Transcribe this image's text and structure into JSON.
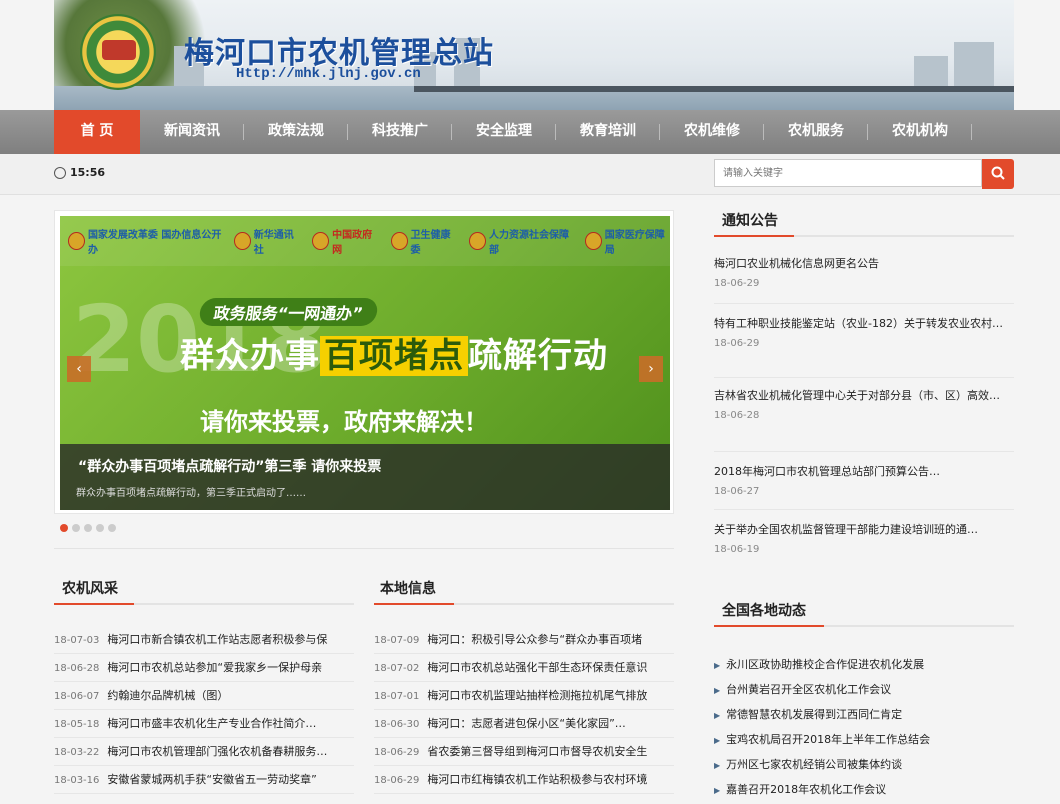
{
  "header": {
    "site_title": "梅河口市农机管理总站",
    "site_url": "Http://mhk.jlnj.gov.cn"
  },
  "nav": {
    "items": [
      {
        "label": "首 页",
        "active": true
      },
      {
        "label": "新闻资讯"
      },
      {
        "label": "政策法规"
      },
      {
        "label": "科技推广"
      },
      {
        "label": "安全监理"
      },
      {
        "label": "教育培训"
      },
      {
        "label": "农机维修"
      },
      {
        "label": "农机服务"
      },
      {
        "label": "农机机构"
      }
    ]
  },
  "toolbar": {
    "time": "15:56",
    "search_placeholder": "请输入关键字"
  },
  "slider": {
    "orgs": [
      "国家发展改革委 国办信息公开办",
      "新华通讯社",
      "中国政府网",
      "卫生健康委",
      "人力资源社会保障部",
      "国家医疗保障局"
    ],
    "year_text": "2018",
    "pill": "政务服务“一网通办”",
    "headline_a": "群众办事",
    "headline_b": "百项堵点",
    "headline_c": "疏解行动",
    "sub": "请你来投票，政府来解决！",
    "caption_title": "“群众办事百项堵点疏解行动”第三季 请你来投票",
    "caption_desc": "群众办事百项堵点疏解行动，第三季正式启动了……",
    "prev": "‹",
    "next": "›",
    "dot_count": 5,
    "active_dot": 1
  },
  "nongji": {
    "title": "农机风采",
    "items": [
      {
        "date": "18-07-03",
        "text": "梅河口市新合镇农机工作站志愿者积极参与保"
      },
      {
        "date": "18-06-28",
        "text": "梅河口市农机总站参加“爱我家乡一保护母亲"
      },
      {
        "date": "18-06-07",
        "text": "约翰迪尔品牌机械（图）"
      },
      {
        "date": "18-05-18",
        "text": "梅河口市盛丰农机化生产专业合作社简介…"
      },
      {
        "date": "18-03-22",
        "text": "梅河口市农机管理部门强化农机备春耕服务…"
      },
      {
        "date": "18-03-16",
        "text": "安徽省蒙城两机手获“安徽省五一劳动奖章”"
      }
    ]
  },
  "local": {
    "title": "本地信息",
    "items": [
      {
        "date": "18-07-09",
        "text": "梅河口：积极引导公众参与“群众办事百项堵"
      },
      {
        "date": "18-07-02",
        "text": "梅河口市农机总站强化干部生态环保责任意识"
      },
      {
        "date": "18-07-01",
        "text": "梅河口市农机监理站抽样检测拖拉机尾气排放"
      },
      {
        "date": "18-06-30",
        "text": "梅河口：志愿者进包保小区“美化家园”…"
      },
      {
        "date": "18-06-29",
        "text": "省农委第三督导组到梅河口市督导农机安全生"
      },
      {
        "date": "18-06-29",
        "text": "梅河口市红梅镇农机工作站积极参与农村环境"
      }
    ]
  },
  "notices": {
    "title": "通知公告",
    "items": [
      {
        "text": "梅河口农业机械化信息网更名公告",
        "date": "18-06-29"
      },
      {
        "text": "特有工种职业技能鉴定站（农业-182）关于转发农业农村…",
        "date": "18-06-29"
      },
      {
        "text": "吉林省农业机械化管理中心关于对部分县（市、区）高效…",
        "date": "18-06-28"
      },
      {
        "text": "2018年梅河口市农机管理总站部门预算公告…",
        "date": "18-06-27"
      },
      {
        "text": "关于举办全国农机监督管理干部能力建设培训班的通…",
        "date": "18-06-19"
      }
    ]
  },
  "national": {
    "title": "全国各地动态",
    "bullet": "▶",
    "items": [
      "永川区政协助推校企合作促进农机化发展",
      "台州黄岩召开全区农机化工作会议",
      "常德智慧农机发展得到江西同仁肯定",
      "宝鸡农机局召开2018年上半年工作总结会",
      "万州区七家农机经销公司被集体约谈",
      "嘉善召开2018年农机化工作会议"
    ]
  },
  "colors": {
    "accent": "#e24a2b",
    "nav_bg": "#8c8c8c",
    "title_blue": "#1c4f9c"
  }
}
